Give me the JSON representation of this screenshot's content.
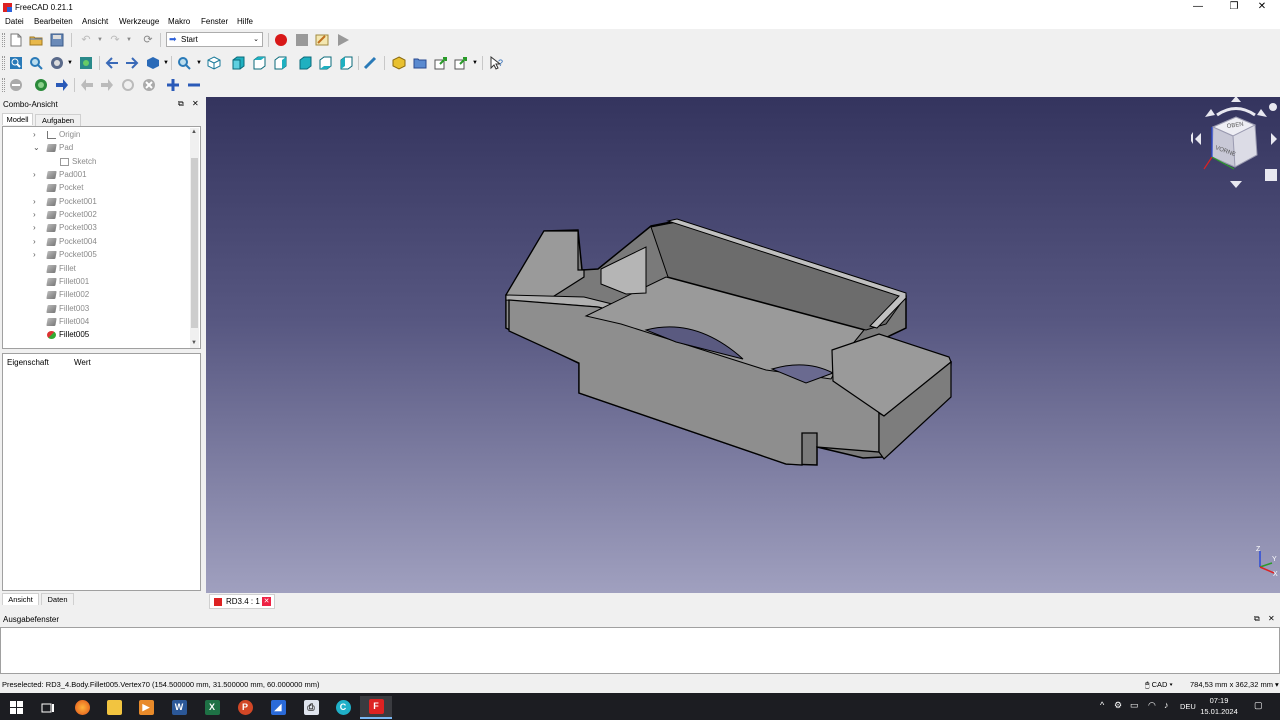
{
  "window": {
    "title": "FreeCAD 0.21.1",
    "controls": [
      "—",
      "❐",
      "✕"
    ]
  },
  "menu": [
    "Datei",
    "Bearbeiten",
    "Ansicht",
    "Werkzeuge",
    "Makro",
    "Fenster",
    "Hilfe"
  ],
  "toolbar": {
    "workbench": "Start"
  },
  "combo": {
    "title": "Combo-Ansicht",
    "tabs": [
      "Modell",
      "Aufgaben"
    ],
    "tree": [
      {
        "label": "Origin",
        "expander": "›",
        "icon": "axes",
        "state": "inactive"
      },
      {
        "label": "Pad",
        "expander": "⌄",
        "icon": "feature",
        "state": "inactive"
      },
      {
        "label": "Sketch",
        "expander": "",
        "icon": "sketch",
        "state": "inactive"
      },
      {
        "label": "Pad001",
        "expander": "›",
        "icon": "feature",
        "state": "inactive"
      },
      {
        "label": "Pocket",
        "expander": "",
        "icon": "feature",
        "state": "inactive"
      },
      {
        "label": "Pocket001",
        "expander": "›",
        "icon": "feature",
        "state": "inactive"
      },
      {
        "label": "Pocket002",
        "expander": "›",
        "icon": "feature",
        "state": "inactive"
      },
      {
        "label": "Pocket003",
        "expander": "›",
        "icon": "feature",
        "state": "inactive"
      },
      {
        "label": "Pocket004",
        "expander": "›",
        "icon": "feature",
        "state": "inactive"
      },
      {
        "label": "Pocket005",
        "expander": "›",
        "icon": "feature",
        "state": "inactive"
      },
      {
        "label": "Fillet",
        "expander": "",
        "icon": "feature",
        "state": "inactive"
      },
      {
        "label": "Fillet001",
        "expander": "",
        "icon": "feature",
        "state": "inactive"
      },
      {
        "label": "Fillet002",
        "expander": "",
        "icon": "feature",
        "state": "inactive"
      },
      {
        "label": "Fillet003",
        "expander": "",
        "icon": "feature",
        "state": "inactive"
      },
      {
        "label": "Fillet004",
        "expander": "",
        "icon": "feature",
        "state": "inactive"
      },
      {
        "label": "Fillet005",
        "expander": "",
        "icon": "active-feature",
        "state": "active"
      }
    ],
    "properties": {
      "col1": "Eigenschaft",
      "col2": "Wert"
    },
    "bottom_tabs": [
      "Ansicht",
      "Daten"
    ]
  },
  "view": {
    "navcube": {
      "top": "OBEN",
      "front": "VORNE"
    },
    "axes": {
      "x": "X",
      "y": "Y",
      "z": "Z"
    }
  },
  "document_tab": {
    "label": "RD3.4 : 1",
    "close": "✕"
  },
  "output": {
    "title": "Ausgabefenster"
  },
  "status": {
    "message": "Preselected: RD3_4.Body.Fillet005.Vertex70 (154.500000 mm, 31.500000 mm, 60.000000 mm)",
    "navigation": "CAD",
    "dimensions": "784,53 mm x 362,32 mm"
  },
  "taskbar": {
    "language": "DEU",
    "time": "07:19",
    "date": "15.01.2024"
  }
}
